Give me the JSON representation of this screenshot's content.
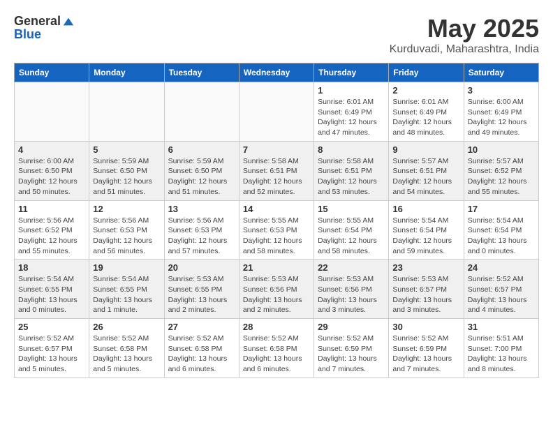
{
  "header": {
    "logo_general": "General",
    "logo_blue": "Blue",
    "month_year": "May 2025",
    "location": "Kurduvadi, Maharashtra, India"
  },
  "days_of_week": [
    "Sunday",
    "Monday",
    "Tuesday",
    "Wednesday",
    "Thursday",
    "Friday",
    "Saturday"
  ],
  "weeks": [
    {
      "shaded": false,
      "days": [
        {
          "date": "",
          "info": ""
        },
        {
          "date": "",
          "info": ""
        },
        {
          "date": "",
          "info": ""
        },
        {
          "date": "",
          "info": ""
        },
        {
          "date": "1",
          "info": "Sunrise: 6:01 AM\nSunset: 6:49 PM\nDaylight: 12 hours\nand 47 minutes."
        },
        {
          "date": "2",
          "info": "Sunrise: 6:01 AM\nSunset: 6:49 PM\nDaylight: 12 hours\nand 48 minutes."
        },
        {
          "date": "3",
          "info": "Sunrise: 6:00 AM\nSunset: 6:49 PM\nDaylight: 12 hours\nand 49 minutes."
        }
      ]
    },
    {
      "shaded": true,
      "days": [
        {
          "date": "4",
          "info": "Sunrise: 6:00 AM\nSunset: 6:50 PM\nDaylight: 12 hours\nand 50 minutes."
        },
        {
          "date": "5",
          "info": "Sunrise: 5:59 AM\nSunset: 6:50 PM\nDaylight: 12 hours\nand 51 minutes."
        },
        {
          "date": "6",
          "info": "Sunrise: 5:59 AM\nSunset: 6:50 PM\nDaylight: 12 hours\nand 51 minutes."
        },
        {
          "date": "7",
          "info": "Sunrise: 5:58 AM\nSunset: 6:51 PM\nDaylight: 12 hours\nand 52 minutes."
        },
        {
          "date": "8",
          "info": "Sunrise: 5:58 AM\nSunset: 6:51 PM\nDaylight: 12 hours\nand 53 minutes."
        },
        {
          "date": "9",
          "info": "Sunrise: 5:57 AM\nSunset: 6:51 PM\nDaylight: 12 hours\nand 54 minutes."
        },
        {
          "date": "10",
          "info": "Sunrise: 5:57 AM\nSunset: 6:52 PM\nDaylight: 12 hours\nand 55 minutes."
        }
      ]
    },
    {
      "shaded": false,
      "days": [
        {
          "date": "11",
          "info": "Sunrise: 5:56 AM\nSunset: 6:52 PM\nDaylight: 12 hours\nand 55 minutes."
        },
        {
          "date": "12",
          "info": "Sunrise: 5:56 AM\nSunset: 6:53 PM\nDaylight: 12 hours\nand 56 minutes."
        },
        {
          "date": "13",
          "info": "Sunrise: 5:56 AM\nSunset: 6:53 PM\nDaylight: 12 hours\nand 57 minutes."
        },
        {
          "date": "14",
          "info": "Sunrise: 5:55 AM\nSunset: 6:53 PM\nDaylight: 12 hours\nand 58 minutes."
        },
        {
          "date": "15",
          "info": "Sunrise: 5:55 AM\nSunset: 6:54 PM\nDaylight: 12 hours\nand 58 minutes."
        },
        {
          "date": "16",
          "info": "Sunrise: 5:54 AM\nSunset: 6:54 PM\nDaylight: 12 hours\nand 59 minutes."
        },
        {
          "date": "17",
          "info": "Sunrise: 5:54 AM\nSunset: 6:54 PM\nDaylight: 13 hours\nand 0 minutes."
        }
      ]
    },
    {
      "shaded": true,
      "days": [
        {
          "date": "18",
          "info": "Sunrise: 5:54 AM\nSunset: 6:55 PM\nDaylight: 13 hours\nand 0 minutes."
        },
        {
          "date": "19",
          "info": "Sunrise: 5:54 AM\nSunset: 6:55 PM\nDaylight: 13 hours\nand 1 minute."
        },
        {
          "date": "20",
          "info": "Sunrise: 5:53 AM\nSunset: 6:55 PM\nDaylight: 13 hours\nand 2 minutes."
        },
        {
          "date": "21",
          "info": "Sunrise: 5:53 AM\nSunset: 6:56 PM\nDaylight: 13 hours\nand 2 minutes."
        },
        {
          "date": "22",
          "info": "Sunrise: 5:53 AM\nSunset: 6:56 PM\nDaylight: 13 hours\nand 3 minutes."
        },
        {
          "date": "23",
          "info": "Sunrise: 5:53 AM\nSunset: 6:57 PM\nDaylight: 13 hours\nand 3 minutes."
        },
        {
          "date": "24",
          "info": "Sunrise: 5:52 AM\nSunset: 6:57 PM\nDaylight: 13 hours\nand 4 minutes."
        }
      ]
    },
    {
      "shaded": false,
      "days": [
        {
          "date": "25",
          "info": "Sunrise: 5:52 AM\nSunset: 6:57 PM\nDaylight: 13 hours\nand 5 minutes."
        },
        {
          "date": "26",
          "info": "Sunrise: 5:52 AM\nSunset: 6:58 PM\nDaylight: 13 hours\nand 5 minutes."
        },
        {
          "date": "27",
          "info": "Sunrise: 5:52 AM\nSunset: 6:58 PM\nDaylight: 13 hours\nand 6 minutes."
        },
        {
          "date": "28",
          "info": "Sunrise: 5:52 AM\nSunset: 6:58 PM\nDaylight: 13 hours\nand 6 minutes."
        },
        {
          "date": "29",
          "info": "Sunrise: 5:52 AM\nSunset: 6:59 PM\nDaylight: 13 hours\nand 7 minutes."
        },
        {
          "date": "30",
          "info": "Sunrise: 5:52 AM\nSunset: 6:59 PM\nDaylight: 13 hours\nand 7 minutes."
        },
        {
          "date": "31",
          "info": "Sunrise: 5:51 AM\nSunset: 7:00 PM\nDaylight: 13 hours\nand 8 minutes."
        }
      ]
    }
  ]
}
